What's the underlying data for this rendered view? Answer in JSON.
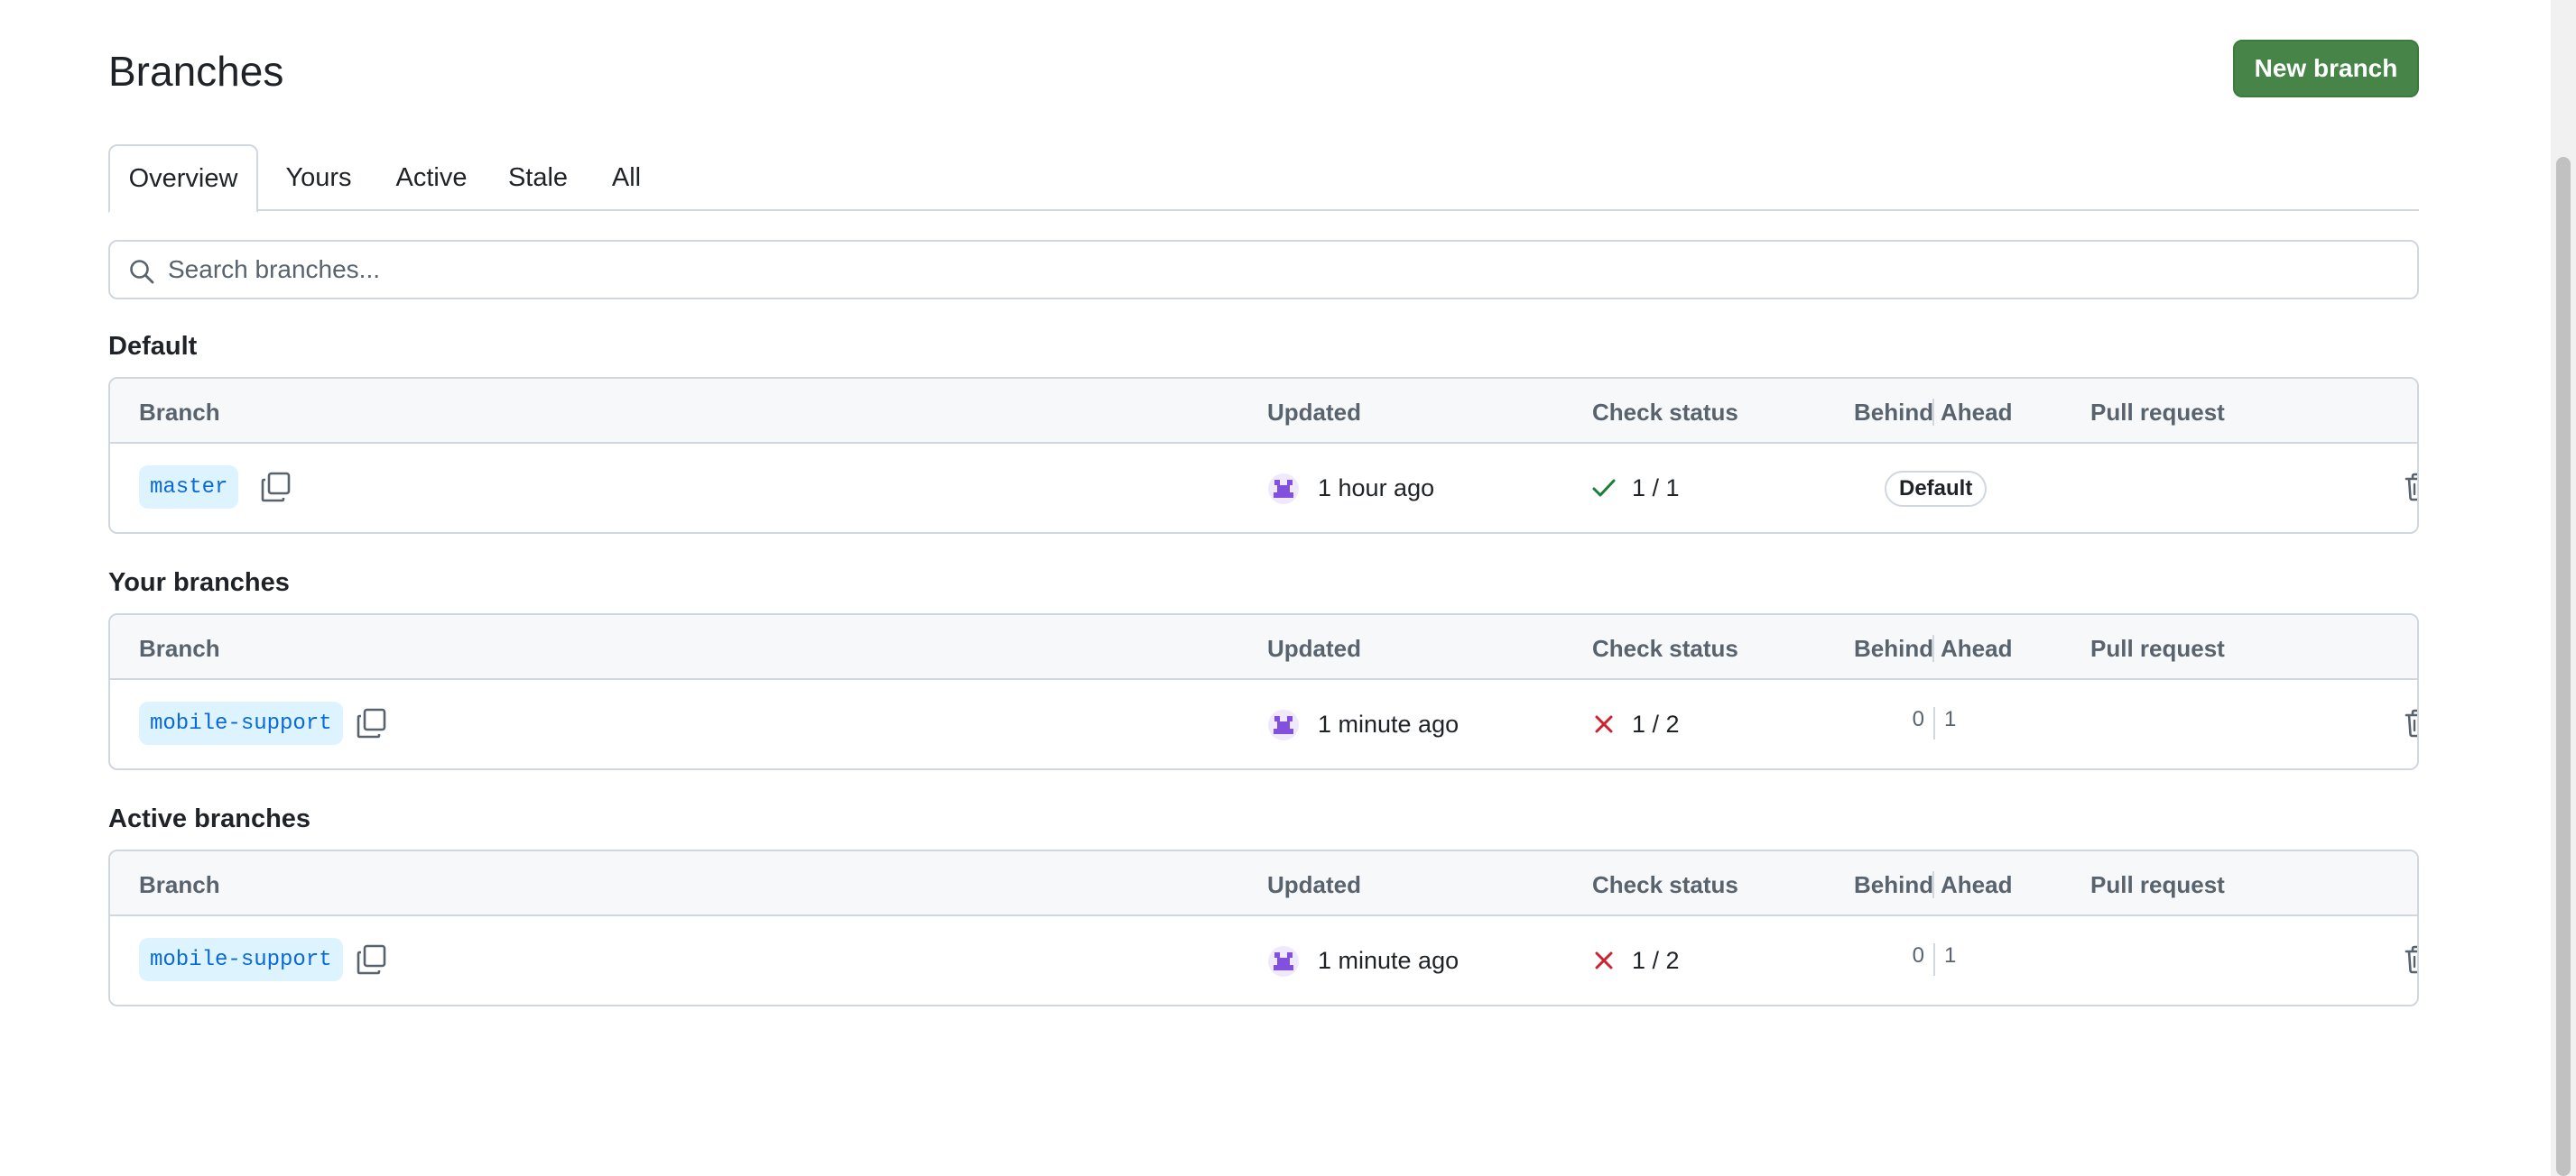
{
  "header": {
    "title": "Branches",
    "new_branch_label": "New branch"
  },
  "tabs": [
    {
      "label": "Overview",
      "active": true
    },
    {
      "label": "Yours",
      "active": false
    },
    {
      "label": "Active",
      "active": false
    },
    {
      "label": "Stale",
      "active": false
    },
    {
      "label": "All",
      "active": false
    }
  ],
  "search": {
    "placeholder": "Search branches...",
    "value": ""
  },
  "columns": {
    "branch": "Branch",
    "updated": "Updated",
    "check_status": "Check status",
    "behind": "Behind",
    "ahead": "Ahead",
    "pull_request": "Pull request"
  },
  "sections": [
    {
      "title": "Default",
      "rows": [
        {
          "branch": "master",
          "updated": "1 hour ago",
          "check_status": "success",
          "check_count": "1 / 1",
          "badge": "Default",
          "behind": "",
          "ahead": "",
          "pull_request": ""
        }
      ]
    },
    {
      "title": "Your branches",
      "rows": [
        {
          "branch": "mobile-support",
          "updated": "1 minute ago",
          "check_status": "failure",
          "check_count": "1 / 2",
          "badge": "",
          "behind": "0",
          "ahead": "1",
          "pull_request": ""
        }
      ]
    },
    {
      "title": "Active branches",
      "rows": [
        {
          "branch": "mobile-support",
          "updated": "1 minute ago",
          "check_status": "failure",
          "check_count": "1 / 2",
          "badge": "",
          "behind": "0",
          "ahead": "1",
          "pull_request": ""
        }
      ]
    }
  ],
  "icons": {
    "search": "search-icon",
    "copy": "copy-icon",
    "avatar": "user-avatar",
    "check": "check-icon",
    "x": "x-icon",
    "trash": "trash-icon",
    "more": "kebab-horizontal-icon"
  },
  "colors": {
    "primary_button": "#468447",
    "link": "#0969da",
    "chip_bg": "#ddf4ff",
    "success": "#1a7f37",
    "danger": "#cf222e",
    "border": "#d0d7de",
    "header_bg": "#f6f8fa"
  }
}
